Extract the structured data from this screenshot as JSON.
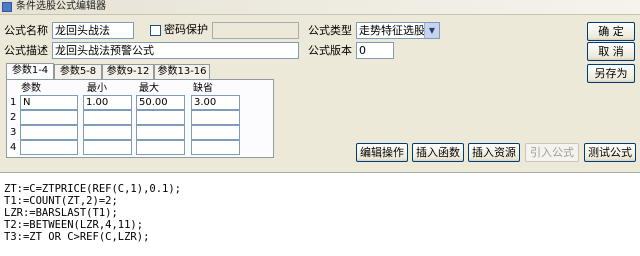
{
  "window": {
    "title": "条件选股公式编辑器"
  },
  "form": {
    "name_label": "公式名称",
    "name_value": "龙回头战法",
    "password_label": "密码保护",
    "password_value": "",
    "desc_label": "公式描述",
    "desc_value": "龙回头战法预警公式",
    "type_label": "公式类型",
    "type_value": "走势特征选股",
    "version_label": "公式版本",
    "version_value": "0"
  },
  "side_buttons": {
    "ok": "确  定",
    "cancel": "取  消",
    "save_as": "另存为"
  },
  "tabs": [
    "参数1-4",
    "参数5-8",
    "参数9-12",
    "参数13-16"
  ],
  "param_table": {
    "headers": [
      "参数",
      "最小",
      "最大",
      "缺省"
    ],
    "rows": [
      {
        "num": "1",
        "name": "N",
        "min": "1.00",
        "max": "50.00",
        "default": "3.00"
      },
      {
        "num": "2",
        "name": "",
        "min": "",
        "max": "",
        "default": ""
      },
      {
        "num": "3",
        "name": "",
        "min": "",
        "max": "",
        "default": ""
      },
      {
        "num": "4",
        "name": "",
        "min": "",
        "max": "",
        "default": ""
      }
    ]
  },
  "toolbar": {
    "edit_ops": "编辑操作",
    "insert_function": "插入函数",
    "insert_resource": "插入资源",
    "import_formula": "引入公式",
    "test_formula": "测试公式"
  },
  "code_lines": [
    "ZT:=C=ZTPRICE(REF(C,1),0.1);",
    "T1:=COUNT(ZT,2)=2;",
    "LZR:=BARSLAST(T1);",
    "T2:=BETWEEN(LZR,4,11);",
    "T3:=ZT OR C>REF(C,LZR);"
  ]
}
